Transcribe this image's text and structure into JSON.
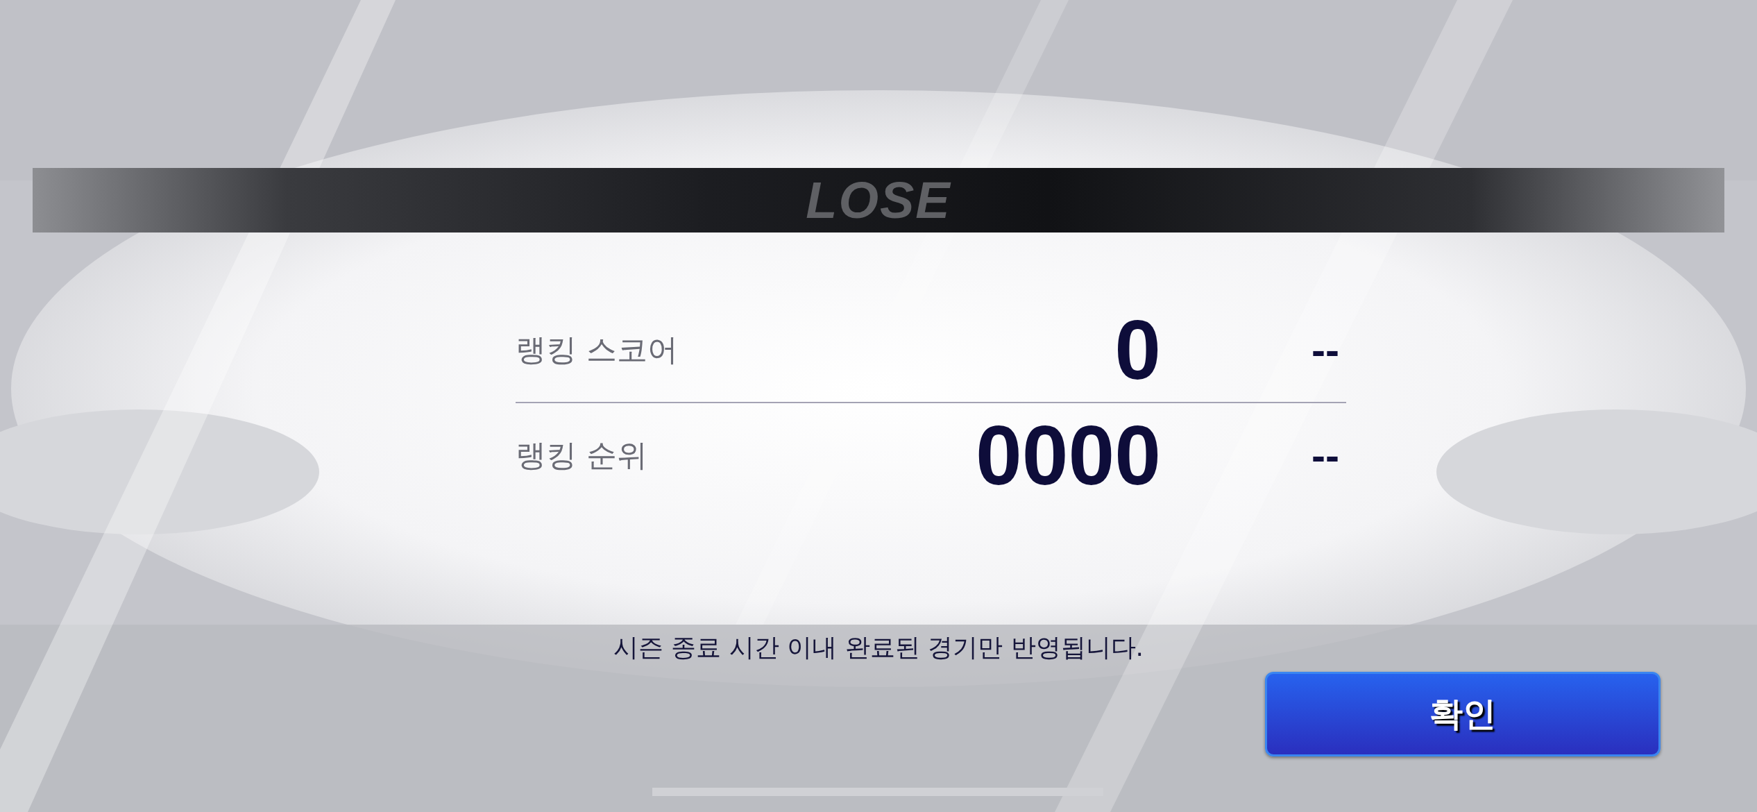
{
  "result_banner": {
    "title": "LOSE"
  },
  "rows": [
    {
      "label": "랭킹 스코어",
      "value": "0",
      "change": "--"
    },
    {
      "label": "랭킹 순위",
      "value": "0000",
      "change": "--"
    }
  ],
  "notice": "시즌 종료 시간 이내 완료된 경기만 반영됩니다.",
  "button": {
    "label": "확인"
  }
}
